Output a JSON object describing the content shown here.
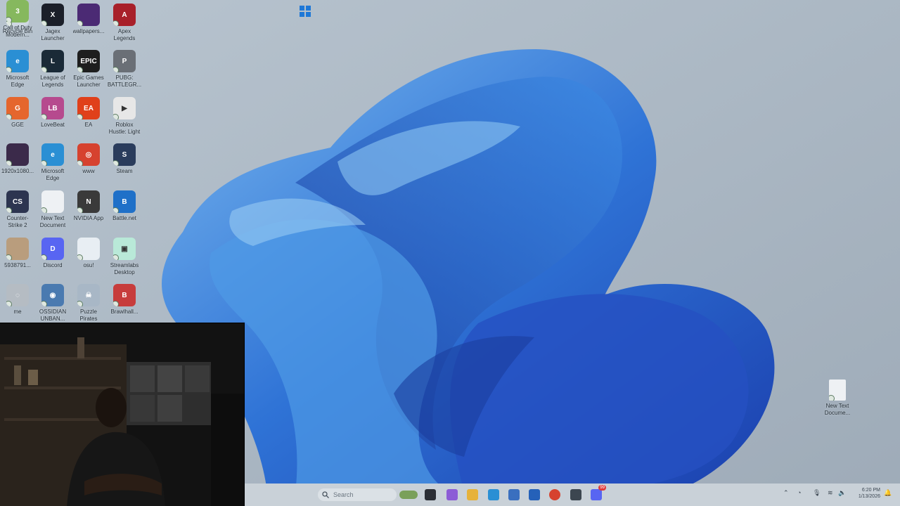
{
  "desktop": {
    "icons": [
      {
        "label": "Recycle Bin",
        "color": "#cfd8e2",
        "glyph": "♻"
      },
      {
        "label": "Jagex Launcher",
        "color": "#1b1f29",
        "glyph": "X"
      },
      {
        "label": "wallpapers...",
        "color": "#4b2a74",
        "glyph": ""
      },
      {
        "label": "Apex Legends",
        "color": "#a8202a",
        "glyph": "A"
      },
      {
        "label": "Microsoft Edge",
        "color": "#2a8fd4",
        "glyph": "e"
      },
      {
        "label": "League of Legends",
        "color": "#1a2a37",
        "glyph": "L"
      },
      {
        "label": "Epic Games Launcher",
        "color": "#1e1e1e",
        "glyph": "EPIC"
      },
      {
        "label": "PUBG: BATTLEGR...",
        "color": "#6a6f76",
        "glyph": "P"
      },
      {
        "label": "GGE",
        "color": "#e5662d",
        "glyph": "G"
      },
      {
        "label": "LoveBeat",
        "color": "#b64a8e",
        "glyph": "LB"
      },
      {
        "label": "EA",
        "color": "#e0401a",
        "glyph": "EA"
      },
      {
        "label": "Roblox Hustle: Light It Up",
        "color": "#e7e7e7",
        "glyph": "▶"
      },
      {
        "label": "1920x1080...",
        "color": "#3b2a4a",
        "glyph": ""
      },
      {
        "label": "Microsoft Edge",
        "color": "#2a8fd4",
        "glyph": "e"
      },
      {
        "label": "www",
        "color": "#d6422f",
        "glyph": "◎"
      },
      {
        "label": "Steam",
        "color": "#2a3c5c",
        "glyph": "S"
      },
      {
        "label": "Counter-Strike 2",
        "color": "#2d3550",
        "glyph": "CS"
      },
      {
        "label": "New Text Document",
        "color": "#eef1f4",
        "glyph": ""
      },
      {
        "label": "NVIDIA App",
        "color": "#3a3a3a",
        "glyph": "N"
      },
      {
        "label": "Battle.net",
        "color": "#1f70c8",
        "glyph": "B"
      },
      {
        "label": "5938791...",
        "color": "#b99d7d",
        "glyph": ""
      },
      {
        "label": "Discord",
        "color": "#5865f2",
        "glyph": "D"
      },
      {
        "label": "osu!",
        "color": "#e8eef3",
        "glyph": ""
      },
      {
        "label": "Streamlabs Desktop",
        "color": "#b9e9d8",
        "glyph": "▣"
      },
      {
        "label": "me",
        "color": "#b5bcc3",
        "glyph": "◌"
      },
      {
        "label": "OSSIDIAN UNBAN...",
        "color": "#4a7ab0",
        "glyph": "◉"
      },
      {
        "label": "Puzzle Pirates",
        "color": "#a8b7c6",
        "glyph": "☠"
      },
      {
        "label": "Brawlhall...",
        "color": "#c73c3c",
        "glyph": "B"
      },
      {
        "label": "Call of Duty Modern...",
        "color": "#86b85e",
        "glyph": "3"
      }
    ],
    "right_icon": {
      "label": "New Text Docume...",
      "color": "#eef1f4"
    }
  },
  "taskbar": {
    "search_placeholder": "Search",
    "time": "6:20 PM",
    "date": "1/13/2026",
    "apps": [
      {
        "name": "start-button",
        "color": "#1e78d7"
      },
      {
        "name": "widgets-button",
        "color": "#7aa05a"
      },
      {
        "name": "terminal-button",
        "color": "#2b2f36"
      },
      {
        "name": "paint-button",
        "color": "#8c5cd6"
      },
      {
        "name": "file-explorer-button",
        "color": "#e6b23a"
      },
      {
        "name": "edge-button",
        "color": "#2a8fd4"
      },
      {
        "name": "store-button",
        "color": "#3a6fbf"
      },
      {
        "name": "outlook-button",
        "color": "#2561b9"
      },
      {
        "name": "chrome-button",
        "color": "#d6422f"
      },
      {
        "name": "streamlabs-button",
        "color": "#3c4650"
      },
      {
        "name": "discord-button",
        "color": "#5865f2"
      }
    ],
    "discord_badge": "99"
  }
}
